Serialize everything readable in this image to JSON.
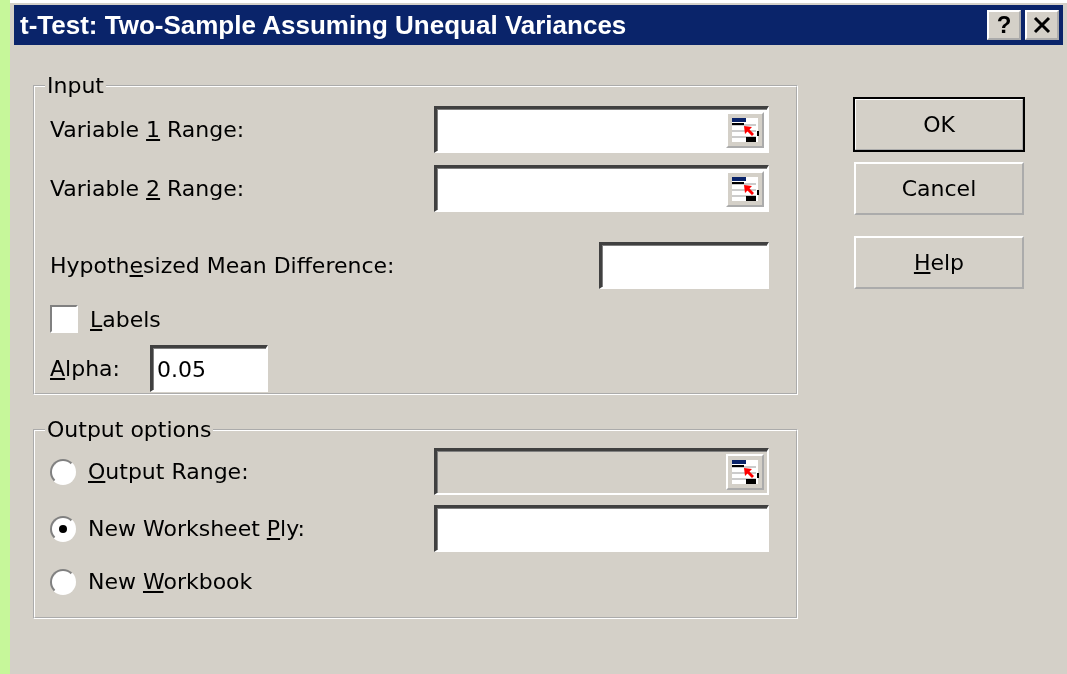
{
  "window": {
    "title": "t-Test: Two-Sample Assuming Unequal Variances"
  },
  "title_buttons": [
    {
      "kind": "help",
      "label": "?"
    },
    {
      "kind": "close"
    }
  ],
  "input": {
    "legend": "Input",
    "rows": [
      {
        "kind": "range",
        "label": {
          "pre": "Variable ",
          "key": "1",
          "post": " Range:"
        }
      },
      {
        "kind": "range",
        "label": {
          "pre": "Variable ",
          "key": "2",
          "post": " Range:"
        }
      },
      {
        "kind": "number",
        "label": {
          "pre": "Hypoth",
          "key": "e",
          "post": "sized Mean Difference:"
        }
      },
      {
        "kind": "checkbox",
        "label": {
          "key": "L",
          "post": "abels"
        },
        "checked": false
      },
      {
        "kind": "short",
        "label": {
          "key": "A",
          "post": "lpha:"
        },
        "value": "0.05"
      }
    ]
  },
  "output": {
    "legend": "Output options",
    "rows": [
      {
        "kind": "range",
        "label": {
          "key": "O",
          "post": "utput Range:"
        },
        "selected": false,
        "disabled": true
      },
      {
        "kind": "text",
        "label": {
          "pre": "New Worksheet ",
          "key": "P",
          "post": "ly:"
        },
        "selected": true,
        "disabled": false
      },
      {
        "kind": "plain",
        "label": {
          "pre": "New ",
          "key": "W",
          "post": "orkbook"
        },
        "selected": false
      }
    ]
  },
  "buttons": [
    {
      "label": {
        "pre": "OK"
      },
      "default": true
    },
    {
      "label": {
        "pre": "Cancel"
      },
      "default": false
    },
    {
      "label": {
        "key": "H",
        "post": "elp"
      },
      "default": false
    }
  ]
}
